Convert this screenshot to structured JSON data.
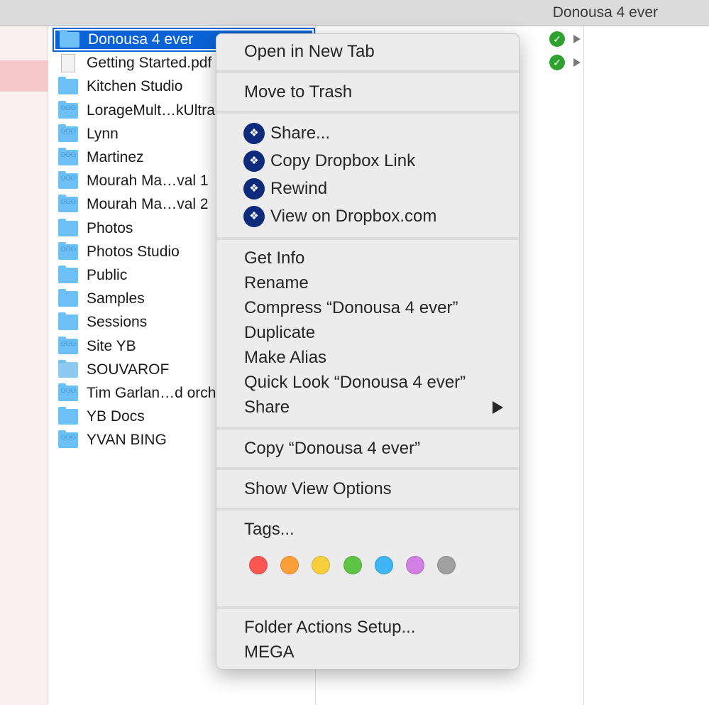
{
  "window": {
    "title": "Donousa 4 ever"
  },
  "files": [
    {
      "name": "Donousa 4 ever",
      "icon": "folder-icon",
      "selected": true
    },
    {
      "name": "Getting Started.pdf",
      "icon": "pdf-icon"
    },
    {
      "name": "Kitchen Studio",
      "icon": "folder-icon"
    },
    {
      "name": "LorageMult…kUltra",
      "icon": "shared-folder-icon"
    },
    {
      "name": "Lynn",
      "icon": "shared-folder-icon"
    },
    {
      "name": "Martinez",
      "icon": "shared-folder-icon"
    },
    {
      "name": "Mourah Ma…val 1",
      "icon": "shared-folder-icon"
    },
    {
      "name": "Mourah Ma…val 2",
      "icon": "shared-folder-icon"
    },
    {
      "name": "Photos",
      "icon": "folder-icon"
    },
    {
      "name": "Photos Studio",
      "icon": "shared-folder-icon"
    },
    {
      "name": "Public",
      "icon": "public-folder-icon"
    },
    {
      "name": "Samples",
      "icon": "folder-icon"
    },
    {
      "name": "Sessions",
      "icon": "folder-icon"
    },
    {
      "name": "Site YB",
      "icon": "shared-folder-icon"
    },
    {
      "name": "SOUVAROF",
      "icon": "locked-folder-icon"
    },
    {
      "name": "Tim Garlan…d orchestra",
      "icon": "shared-folder-icon"
    },
    {
      "name": "YB Docs",
      "icon": "folder-icon"
    },
    {
      "name": "YVAN BING",
      "icon": "shared-folder-icon"
    }
  ],
  "menu": {
    "open_new_tab": "Open in New Tab",
    "move_to_trash": "Move to Trash",
    "dropbox": [
      "Share...",
      "Copy Dropbox Link",
      "Rewind",
      "View on Dropbox.com"
    ],
    "info": [
      "Get Info",
      "Rename",
      "Compress “Donousa 4 ever”",
      "Duplicate",
      "Make Alias",
      "Quick Look “Donousa 4 ever”",
      "Share"
    ],
    "copy": "Copy “Donousa 4 ever”",
    "show_view_options": "Show View Options",
    "tags": "Tags...",
    "tag_colors": [
      "#fc5753",
      "#fd9f38",
      "#f7cf3b",
      "#5ec544",
      "#3db5f6",
      "#d27fe3",
      "#a0a0a0"
    ],
    "folder_actions": "Folder Actions Setup...",
    "mega": "MEGA"
  }
}
